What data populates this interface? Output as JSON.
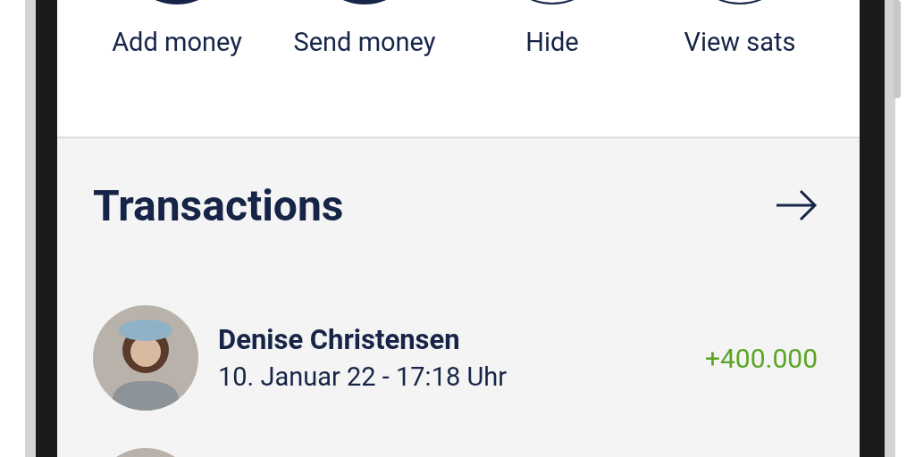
{
  "actions": [
    {
      "label": "Add money",
      "filled": true
    },
    {
      "label": "Send money",
      "filled": true
    },
    {
      "label": "Hide",
      "filled": false
    },
    {
      "label": "View sats",
      "filled": false
    }
  ],
  "transactions": {
    "title": "Transactions",
    "items": [
      {
        "name": "Denise Christensen",
        "date": "10. Januar 22 - 17:18 Uhr",
        "amount": "+400.000",
        "kind": "entry"
      },
      {
        "kind": "peek"
      }
    ]
  }
}
